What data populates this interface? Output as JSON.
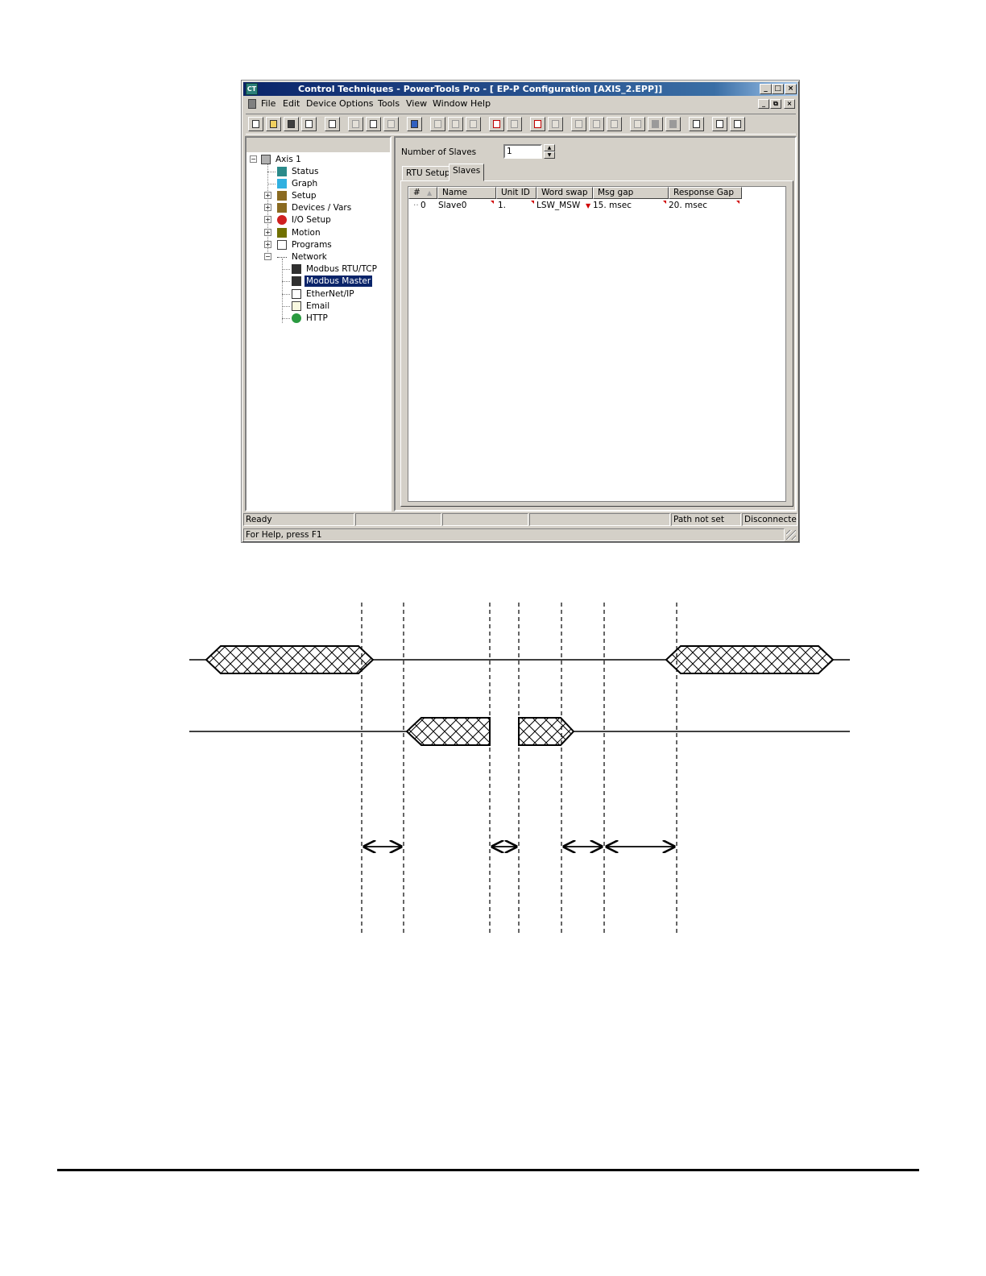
{
  "window": {
    "title": "Control Techniques - PowerTools Pro - [ EP-P Configuration  [AXIS_2.EPP]]",
    "caption_buttons": [
      "_",
      "□",
      "×"
    ],
    "mdi_buttons": [
      "_",
      "⧉",
      "×"
    ]
  },
  "menu": [
    "File",
    "Edit",
    "Device",
    "Options",
    "Tools",
    "View",
    "Window",
    "Help"
  ],
  "toolbar_icons": [
    "new-icon",
    "open-icon",
    "save-icon",
    "print-icon",
    "upload-config-icon",
    "upload-icon",
    "download-icon",
    "sync-icon",
    "connect-icon",
    "insert-icon",
    "remove-icon",
    "delete-icon",
    "add-item-icon",
    "remove-item-icon",
    "view-icon",
    "report-icon",
    "zoom-icon",
    "watch-icon",
    "binoculars-icon",
    "device-icon",
    "stop-icon",
    "run-icon",
    "layout-icon",
    "help-icon",
    "context-help-icon"
  ],
  "tree": {
    "root": "Axis 1",
    "items": [
      {
        "label": "Status"
      },
      {
        "label": "Graph"
      },
      {
        "label": "Setup"
      },
      {
        "label": "Devices / Vars"
      },
      {
        "label": "I/O Setup"
      },
      {
        "label": "Motion"
      },
      {
        "label": "Programs"
      },
      {
        "label": "Network"
      }
    ],
    "network_children": [
      {
        "label": "Modbus RTU/TCP"
      },
      {
        "label": "Modbus Master"
      },
      {
        "label": "EtherNet/IP"
      },
      {
        "label": "Email"
      },
      {
        "label": "HTTP"
      }
    ],
    "selected": "Modbus Master"
  },
  "config": {
    "number_of_slaves_label": "Number of Slaves",
    "number_of_slaves": "1",
    "tabs": [
      "RTU Setup",
      "Slaves"
    ],
    "active_tab": "Slaves",
    "columns": [
      "#",
      "Name",
      "Unit ID",
      "Word swap",
      "Msg gap",
      "Response Gap"
    ],
    "rows": [
      {
        "index": "0",
        "name": "Slave0",
        "unit_id": "1.",
        "word_swap": "LSW_MSW",
        "msg_gap": "15. msec",
        "response_gap": "20. msec"
      }
    ]
  },
  "status": {
    "ready": "Ready",
    "path": "Path not set",
    "connection": "Disconnected",
    "help": "For Help, press F1"
  }
}
